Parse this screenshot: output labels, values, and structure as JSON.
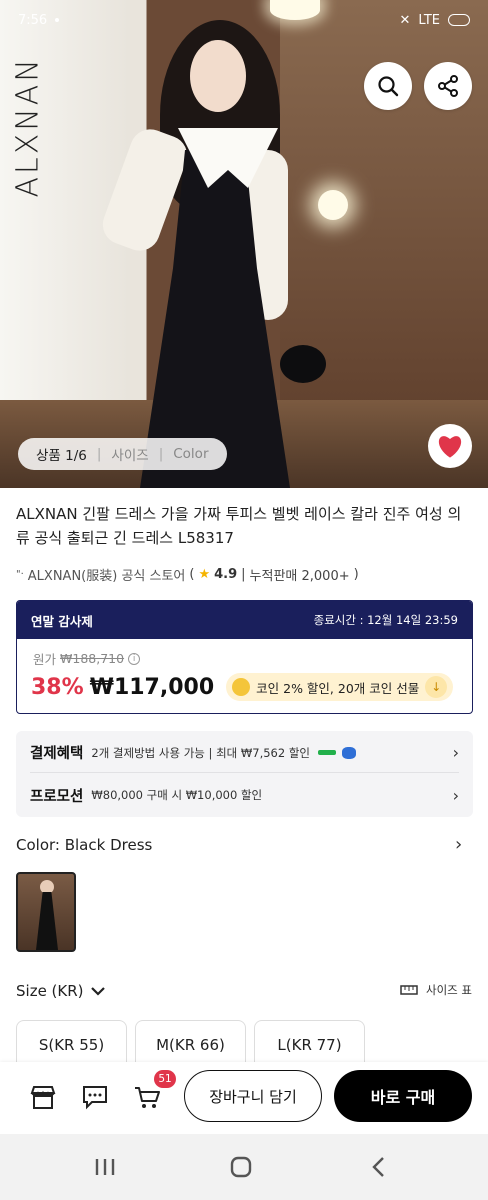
{
  "status_bar": {
    "time": "7:56",
    "network": "LTE"
  },
  "hero": {
    "brand_vertical": "ALXNAN",
    "tabs": {
      "product": "상품 1/6",
      "size": "사이즈",
      "color": "Color"
    }
  },
  "product": {
    "title": "ALXNAN 긴팔 드레스 가을 가짜 투피스 벨벳 레이스 칼라 진주 여성 의류 공식 출퇴근 긴 드레스 L58317",
    "store": "ALXNAN(服装) 공식 스토어",
    "rating": "4.9",
    "sales": "누적판매 2,000+"
  },
  "price_box": {
    "sale_label": "연말 감사제",
    "end_time": "종료시간 : 12월 14일 23:59",
    "original_label": "원가",
    "original_price": "₩188,710",
    "discount": "38%",
    "price": "₩117,000",
    "coin_text": "코인 2% 할인, 20개 코인 선물"
  },
  "benefits": {
    "payment_label": "결제혜택",
    "payment_text": "2개 결제방법 사용 가능 | 최대 ₩7,562 할인",
    "promo_label": "프로모션",
    "promo_text": "₩80,000 구매 시 ₩10,000 할인"
  },
  "options": {
    "color_label": "Color: Black Dress",
    "size_label": "Size (KR)",
    "size_chart": "사이즈 표",
    "sizes": [
      "S(KR 55)",
      "M(KR 66)",
      "L(KR 77)"
    ]
  },
  "bottom_bar": {
    "cart_count": "51",
    "add_to_cart": "장바구니 담기",
    "buy_now": "바로 구매"
  },
  "colors": {
    "navy": "#1a1f5c",
    "red": "#e0354a",
    "black": "#000000"
  }
}
